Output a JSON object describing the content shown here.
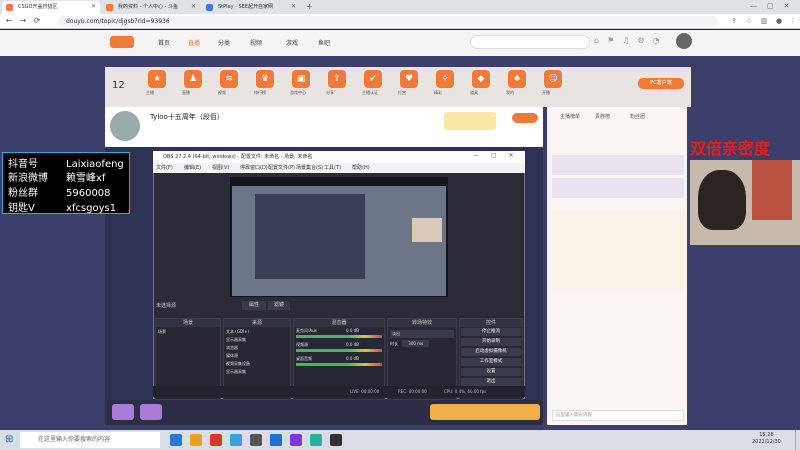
{
  "browser": {
    "tabs": [
      {
        "title": "CSGO开盖狩猎区",
        "active": true
      },
      {
        "title": "我的资料 - 个人中心 - 斗鱼",
        "active": false
      },
      {
        "title": "StPlay - SEE起开自家网",
        "active": false
      }
    ],
    "url": "douyu.com/topic/djgsb?rid=93936"
  },
  "site": {
    "nav": [
      "首页",
      "直播",
      "分类",
      "视频",
      "游戏",
      "鱼吧"
    ],
    "game_icons": [
      "主播",
      "直播",
      "视频",
      "排行榜",
      "游戏中心",
      "分享",
      "主播认证",
      "打赏",
      "精彩",
      "道具",
      "我的",
      "开播"
    ],
    "stream_title": "Tyloo十五周年（段佰）",
    "room_badge": "12",
    "corner_label": "PC客户端"
  },
  "obs": {
    "title": "OBS 27.2.4 (64-bit, windows) - 配置文件: 未命名 - 场景: 未命名",
    "menu": [
      "文件(F)",
      "编辑(E)",
      "视图(V)",
      "停靠窗口(D)",
      "配置文件(P)",
      "场景集合(S)",
      "工具(T)",
      "帮助(H)"
    ],
    "no_source": "未选择源",
    "btn_props": "属性",
    "btn_filters": "滤镜",
    "docks": {
      "scenes": {
        "title": "场景",
        "items": [
          "场景"
        ]
      },
      "sources": {
        "title": "来源",
        "items": [
          "文本 (GDI+)",
          "显示器采集",
          "浏览器",
          "媒体源",
          "视频采集设备",
          "显示器采集"
        ]
      },
      "mixer": {
        "title": "混音器",
        "items": [
          "麦克风/Aux",
          "视频源",
          "桌面音频"
        ],
        "level": "0.0 dB"
      },
      "transitions": {
        "title": "转场特效",
        "type": "淡出",
        "duration_label": "时长",
        "duration": "300 ms"
      },
      "controls": {
        "title": "控件",
        "buttons": [
          "停止推流",
          "开始录制",
          "启动虚拟摄像机",
          "工作室模式",
          "设置",
          "退出"
        ]
      }
    },
    "status": {
      "live": "LIVE: 00:00:00",
      "rec": "REC: 00:00:00",
      "cpu": "CPU: 0.4%, 60.00 fps"
    }
  },
  "social": {
    "rows": [
      {
        "key": "抖音号",
        "value": "Laixiaofeng"
      },
      {
        "key": "新浪微博",
        "value": "赖雪峰xf"
      },
      {
        "key": "粉丝群",
        "value": "5960008"
      },
      {
        "key": "钥匙V",
        "value": "xfcsgoys1"
      }
    ]
  },
  "overlay_title": "双倍亲密度",
  "chat": {
    "tabs": [
      "主播榜单",
      "贵族榜",
      "粉丝团"
    ],
    "input_placeholder": "这里输入聊天内容"
  },
  "taskbar": {
    "search_placeholder": "在这里输入你要搜索的内容",
    "time": "15:28",
    "date": "2022/12/30"
  },
  "colors": {
    "accent": "#f07a3a",
    "site_bg": "#3b3f6a",
    "obs_bg": "#2b2c37",
    "overlay_red": "#e02020"
  }
}
